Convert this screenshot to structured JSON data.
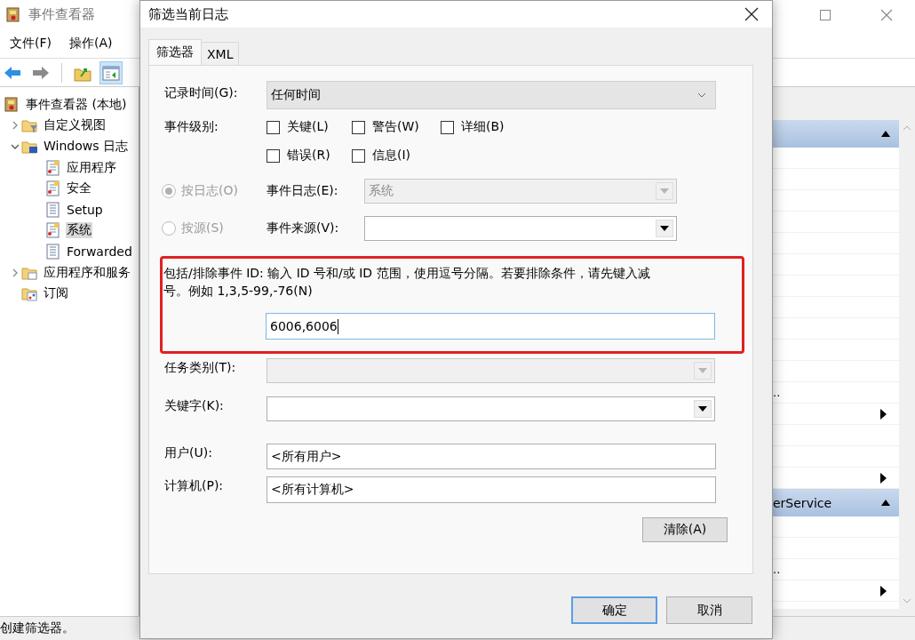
{
  "app": {
    "title": "事件查看器",
    "menu": [
      {
        "label": "文件(F)"
      },
      {
        "label": "操作(A)"
      }
    ],
    "toolbar": [
      {
        "selected": false
      },
      {
        "selected": false
      },
      {
        "selected": false
      },
      {
        "selected": true
      }
    ],
    "tree": [
      {
        "label": "事件查看器 (本地)",
        "kind": "viewer",
        "selected": false,
        "children": [
          {
            "label": "自定义视图",
            "kind": "filter-folder",
            "expanded": false,
            "selected": false
          },
          {
            "label": "Windows 日志",
            "kind": "logs-folder",
            "expanded": true,
            "selected": false,
            "children": [
              {
                "label": "应用程序",
                "kind": "log",
                "selected": false
              },
              {
                "label": "安全",
                "kind": "log",
                "selected": false
              },
              {
                "label": "Setup",
                "kind": "plain-log",
                "selected": false
              },
              {
                "label": "系统",
                "kind": "log",
                "selected": true
              },
              {
                "label": "Forwarded",
                "kind": "plain-log",
                "selected": false
              }
            ]
          },
          {
            "label": "应用程序和服务",
            "kind": "folder",
            "expanded": false,
            "selected": false
          },
          {
            "label": "订阅",
            "kind": "subscription",
            "selected": false
          }
        ]
      }
    ],
    "actions": [
      {
        "kind": "header"
      },
      {
        "kind": "item",
        "submenu": false
      },
      {
        "kind": "item",
        "submenu": false
      },
      {
        "kind": "item",
        "submenu": false
      },
      {
        "kind": "item",
        "submenu": false
      },
      {
        "kind": "item",
        "submenu": false
      },
      {
        "kind": "item",
        "submenu": false
      },
      {
        "kind": "item",
        "submenu": false
      },
      {
        "kind": "item",
        "submenu": false
      },
      {
        "kind": "item",
        "submenu": false
      },
      {
        "kind": "item",
        "submenu": false
      },
      {
        "kind": "item",
        "submenu": false
      },
      {
        "kind": "item",
        "label": "..",
        "submenu": false
      },
      {
        "kind": "item",
        "submenu": true
      },
      {
        "kind": "item",
        "submenu": false
      },
      {
        "kind": "item",
        "submenu": false
      },
      {
        "kind": "item",
        "submenu": true
      },
      {
        "kind": "header",
        "label": "erService"
      },
      {
        "kind": "item",
        "submenu": false
      },
      {
        "kind": "item",
        "submenu": false
      },
      {
        "kind": "item",
        "label": "..",
        "submenu": false
      },
      {
        "kind": "item",
        "submenu": true
      }
    ],
    "status": "创建筛选器。"
  },
  "dialog": {
    "title": "筛选当前日志",
    "tabs": [
      {
        "label": "筛选器",
        "selected": true
      },
      {
        "label": "XML",
        "selected": false
      }
    ],
    "logged": {
      "label": "记录时间(G):",
      "value": "任何时间"
    },
    "level": {
      "label": "事件级别:",
      "options": [
        {
          "label": "关键(L)",
          "checked": false
        },
        {
          "label": "警告(W)",
          "checked": false
        },
        {
          "label": "详细(B)",
          "checked": false
        },
        {
          "label": "错误(R)",
          "checked": false
        },
        {
          "label": "信息(I)",
          "checked": false
        }
      ]
    },
    "sources": [
      {
        "label": "按日志(O)",
        "selected": true,
        "disabled": true,
        "field_label": "事件日志(E):",
        "value": "系统",
        "field_disabled": true
      },
      {
        "label": "按源(S)",
        "selected": false,
        "disabled": true,
        "field_label": "事件来源(V):",
        "field_disabled": false
      }
    ],
    "event_ids": {
      "label": "包括/排除事件 ID: 输入 ID 号和/或 ID 范围，使用逗号分隔。若要排除条件，请先键入减号。例如 1,3,5-99,-76(N)",
      "value": "6006,6006",
      "highlighted": true
    },
    "task": {
      "label": "任务类别(T):",
      "disabled": true
    },
    "keywords": {
      "label": "关键字(K):",
      "disabled": false
    },
    "user": {
      "label": "用户(U):",
      "value": "<所有用户>"
    },
    "computer": {
      "label": "计算机(P):",
      "value": "<所有计算机>"
    },
    "clear_button": "清除(A)",
    "buttons": [
      {
        "label": "确定",
        "default": true
      },
      {
        "label": "取消",
        "default": false
      }
    ]
  }
}
